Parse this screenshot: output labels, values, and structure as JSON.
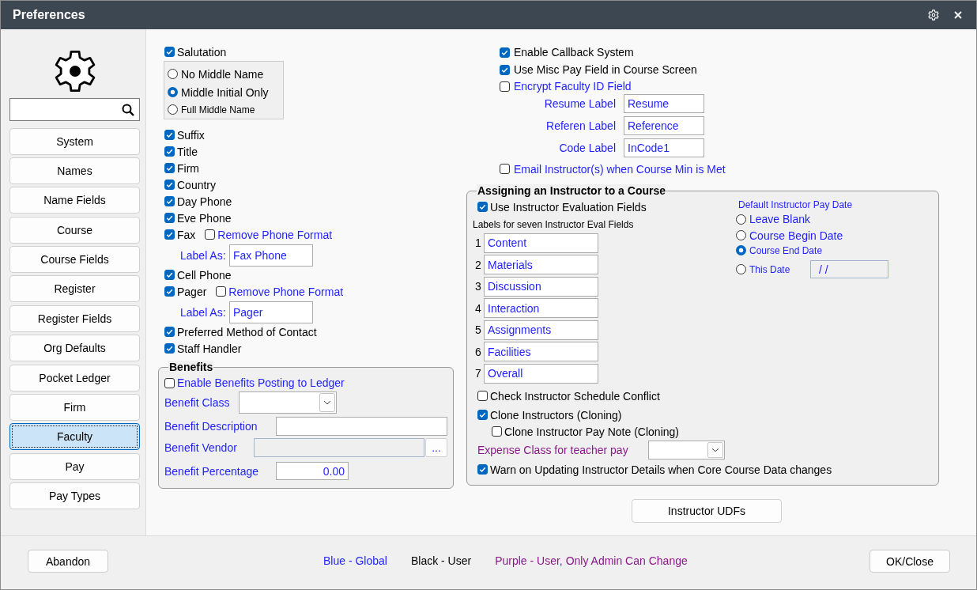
{
  "window": {
    "title": "Preferences"
  },
  "sidebar": {
    "items": [
      {
        "label": "System",
        "selected": false
      },
      {
        "label": "Names",
        "selected": false
      },
      {
        "label": "Name Fields",
        "selected": false
      },
      {
        "label": "Course",
        "selected": false
      },
      {
        "label": "Course Fields",
        "selected": false
      },
      {
        "label": "Register",
        "selected": false
      },
      {
        "label": "Register Fields",
        "selected": false
      },
      {
        "label": "Org Defaults",
        "selected": false
      },
      {
        "label": "Pocket Ledger",
        "selected": false
      },
      {
        "label": "Firm",
        "selected": false
      },
      {
        "label": "Faculty",
        "selected": true
      },
      {
        "label": "Pay",
        "selected": false
      },
      {
        "label": "Pay Types",
        "selected": false
      }
    ]
  },
  "name_fields": {
    "items": [
      {
        "kind": "checkbox",
        "label": "Salutation",
        "checked": true,
        "color": "#000000"
      },
      {
        "kind": "radio_group",
        "options": [
          {
            "label": "No Middle Name",
            "selected": false,
            "color": "#000000"
          },
          {
            "label": "Middle Initial Only",
            "selected": true,
            "color": "#000000"
          },
          {
            "label": "Full Middle Name",
            "selected": false,
            "color": "#000000"
          }
        ]
      },
      {
        "kind": "checkbox",
        "label": "Suffix",
        "checked": true,
        "color": "#000000"
      },
      {
        "kind": "checkbox",
        "label": "Title",
        "checked": true,
        "color": "#000000"
      },
      {
        "kind": "checkbox",
        "label": "Firm",
        "checked": true,
        "color": "#000000"
      },
      {
        "kind": "checkbox",
        "label": "Country",
        "checked": true,
        "color": "#000000"
      },
      {
        "kind": "checkbox",
        "label": "Day Phone",
        "checked": true,
        "color": "#000000"
      },
      {
        "kind": "checkbox",
        "label": "Eve Phone",
        "checked": true,
        "color": "#000000"
      },
      {
        "kind": "phone",
        "label": "Fax",
        "checked": true,
        "color": "#000000",
        "remove_format": {
          "label": "Remove Phone Format",
          "checked": false,
          "color": "#1f1fff"
        },
        "label_as": {
          "label": "Label As:",
          "value": "Fax Phone",
          "color": "#1f1fff"
        }
      },
      {
        "kind": "checkbox",
        "label": "Cell Phone",
        "checked": true,
        "color": "#000000"
      },
      {
        "kind": "phone",
        "label": "Pager",
        "checked": true,
        "color": "#000000",
        "remove_format": {
          "label": "Remove Phone Format",
          "checked": false,
          "color": "#1f1fff"
        },
        "label_as": {
          "label": "Label As:",
          "value": "Pager",
          "color": "#1f1fff"
        }
      },
      {
        "kind": "checkbox",
        "label": "Preferred Method of Contact",
        "checked": true,
        "color": "#000000"
      },
      {
        "kind": "checkbox",
        "label": "Staff Handler",
        "checked": true,
        "color": "#000000"
      }
    ]
  },
  "benefits": {
    "title": "Benefits",
    "enable_posting": {
      "label": "Enable Benefits Posting to Ledger",
      "checked": false,
      "color": "#1f1fff"
    },
    "rows": [
      {
        "kind": "dropdown",
        "label": "Benefit Class",
        "color": "#1f1fff",
        "disabled": false
      },
      {
        "kind": "text",
        "label": "Benefit Description",
        "color": "#1f1fff",
        "disabled": false
      },
      {
        "kind": "lookup",
        "label": "Benefit Vendor",
        "color": "#1f1fff",
        "disabled": true,
        "button": "..."
      },
      {
        "kind": "number",
        "label": "Benefit Percentage",
        "color": "#1f1fff",
        "disabled": false,
        "value": "0.00"
      }
    ]
  },
  "faculty_options": {
    "checks": [
      {
        "label": "Enable Callback System",
        "checked": true,
        "color": "#000000"
      },
      {
        "label": "Use Misc Pay Field in Course Screen",
        "checked": true,
        "color": "#000000"
      },
      {
        "label": "Encrypt Faculty ID Field",
        "checked": false,
        "color": "#1f1fff"
      }
    ],
    "labels": [
      {
        "label": "Resume Label",
        "value": "Resume",
        "color": "#1f1fff"
      },
      {
        "label": "Referen Label",
        "value": "Reference",
        "color": "#1f1fff"
      },
      {
        "label": "Code Label",
        "value": "InCode1",
        "color": "#1f1fff"
      }
    ],
    "email": {
      "label": "Email Instructor(s) when Course Min is Met",
      "checked": false,
      "color": "#1f1fff"
    }
  },
  "instructor_assignment": {
    "title": "Assigning an Instructor to a Course",
    "use_eval": {
      "label": "Use Instructor Evaluation Fields",
      "checked": true,
      "color": "#000000"
    },
    "eval_caption": "Labels for seven Instructor Eval Fields",
    "eval_fields": [
      {
        "number": "1",
        "value": "Content",
        "color": "#1f1fff"
      },
      {
        "number": "2",
        "value": "Materials",
        "color": "#1f1fff"
      },
      {
        "number": "3",
        "value": "Discussion",
        "color": "#1f1fff"
      },
      {
        "number": "4",
        "value": "Interaction",
        "color": "#1f1fff"
      },
      {
        "number": "5",
        "value": "Assignments",
        "color": "#1f1fff"
      },
      {
        "number": "6",
        "value": "Facilities",
        "color": "#1f1fff"
      },
      {
        "number": "7",
        "value": "Overall",
        "color": "#1f1fff"
      }
    ],
    "pay_date": {
      "title": "Default Instructor Pay Date",
      "color": "#1f1fff",
      "options": [
        {
          "label": "Leave Blank",
          "selected": false
        },
        {
          "label": "Course Begin Date",
          "selected": false
        },
        {
          "label": "Course End Date",
          "selected": true
        },
        {
          "label": "This Date",
          "selected": false,
          "date_value": "/ /"
        }
      ]
    },
    "options": [
      {
        "label": "Check Instructor Schedule Conflict",
        "checked": false,
        "color": "#000000"
      },
      {
        "label": "Clone Instructors (Cloning)",
        "checked": true,
        "color": "#000000",
        "children": [
          {
            "label": "Clone Instructor Pay Note (Cloning)",
            "checked": false,
            "color": "#000000"
          }
        ]
      }
    ],
    "expense_class": {
      "label": "Expense Class for teacher pay",
      "color": "#8a1a8a"
    },
    "warn": {
      "label": "Warn on Updating Instructor Details when Core Course Data changes",
      "checked": true,
      "color": "#000000"
    }
  },
  "instructor_udfs_button": "Instructor UDFs",
  "footer": {
    "abandon_button": "Abandon",
    "legend": [
      {
        "label": "Blue - Global",
        "color": "#1f1fff"
      },
      {
        "label": "Black - User",
        "color": "#000000"
      },
      {
        "label": "Purple - User, Only Admin Can Change",
        "color": "#8a1a8a"
      }
    ],
    "ok_button": "OK/Close"
  }
}
